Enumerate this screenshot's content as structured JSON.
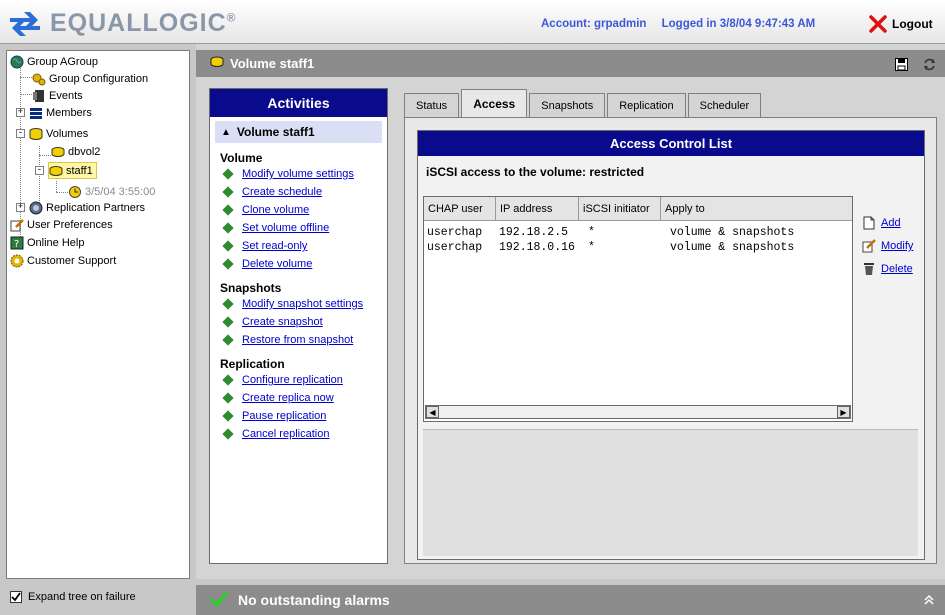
{
  "header": {
    "brand": "EQUALLOGIC",
    "brand_mark": "®",
    "account": "Account: grpadmin",
    "logged_in": "Logged in 3/8/04 9:47:43 AM",
    "logout_label": "Logout",
    "colors": {
      "account_text": "#3d58d6",
      "logout_x": "#e01010"
    }
  },
  "tree": {
    "group": "Group AGroup",
    "group_configuration": "Group Configuration",
    "events": "Events",
    "members": "Members",
    "volumes": "Volumes",
    "volume_dbvol2": "dbvol2",
    "volume_staff1": "staff1",
    "snapshot": "3/5/04 3:55:00",
    "replication_partners": "Replication Partners",
    "user_preferences": "User Preferences",
    "online_help": "Online Help",
    "customer_support": "Customer Support"
  },
  "expand_tree_label": "Expand tree on failure",
  "page_header": {
    "title": "Volume staff1"
  },
  "activities": {
    "title": "Activities",
    "selected": "Volume staff1",
    "sections": [
      {
        "heading": "Volume",
        "links": [
          "Modify volume settings",
          "Create schedule",
          "Clone volume",
          "Set volume offline",
          "Set read-only",
          "Delete volume"
        ]
      },
      {
        "heading": "Snapshots",
        "links": [
          "Modify snapshot settings",
          "Create snapshot",
          "Restore from snapshot"
        ]
      },
      {
        "heading": "Replication",
        "links": [
          "Configure replication",
          "Create replica now",
          "Pause replication",
          "Cancel replication"
        ]
      }
    ]
  },
  "tabs": [
    {
      "label": "Status",
      "active": false
    },
    {
      "label": "Access",
      "active": true
    },
    {
      "label": "Snapshots",
      "active": false
    },
    {
      "label": "Replication",
      "active": false
    },
    {
      "label": "Scheduler",
      "active": false
    }
  ],
  "acl": {
    "title": "Access Control List",
    "subtitle": "iSCSI access to the volume:  restricted",
    "columns": [
      "CHAP user",
      "IP address",
      "iSCSI initiator",
      "Apply to"
    ],
    "rows": [
      [
        "userchap",
        "192.18.2.5",
        "*",
        "volume & snapshots"
      ],
      [
        "userchap",
        "192.18.0.16",
        "*",
        "volume & snapshots"
      ]
    ],
    "buttons": {
      "add": "Add",
      "modify": "Modify",
      "delete": "Delete"
    }
  },
  "alarm": {
    "text": "No outstanding alarms"
  }
}
